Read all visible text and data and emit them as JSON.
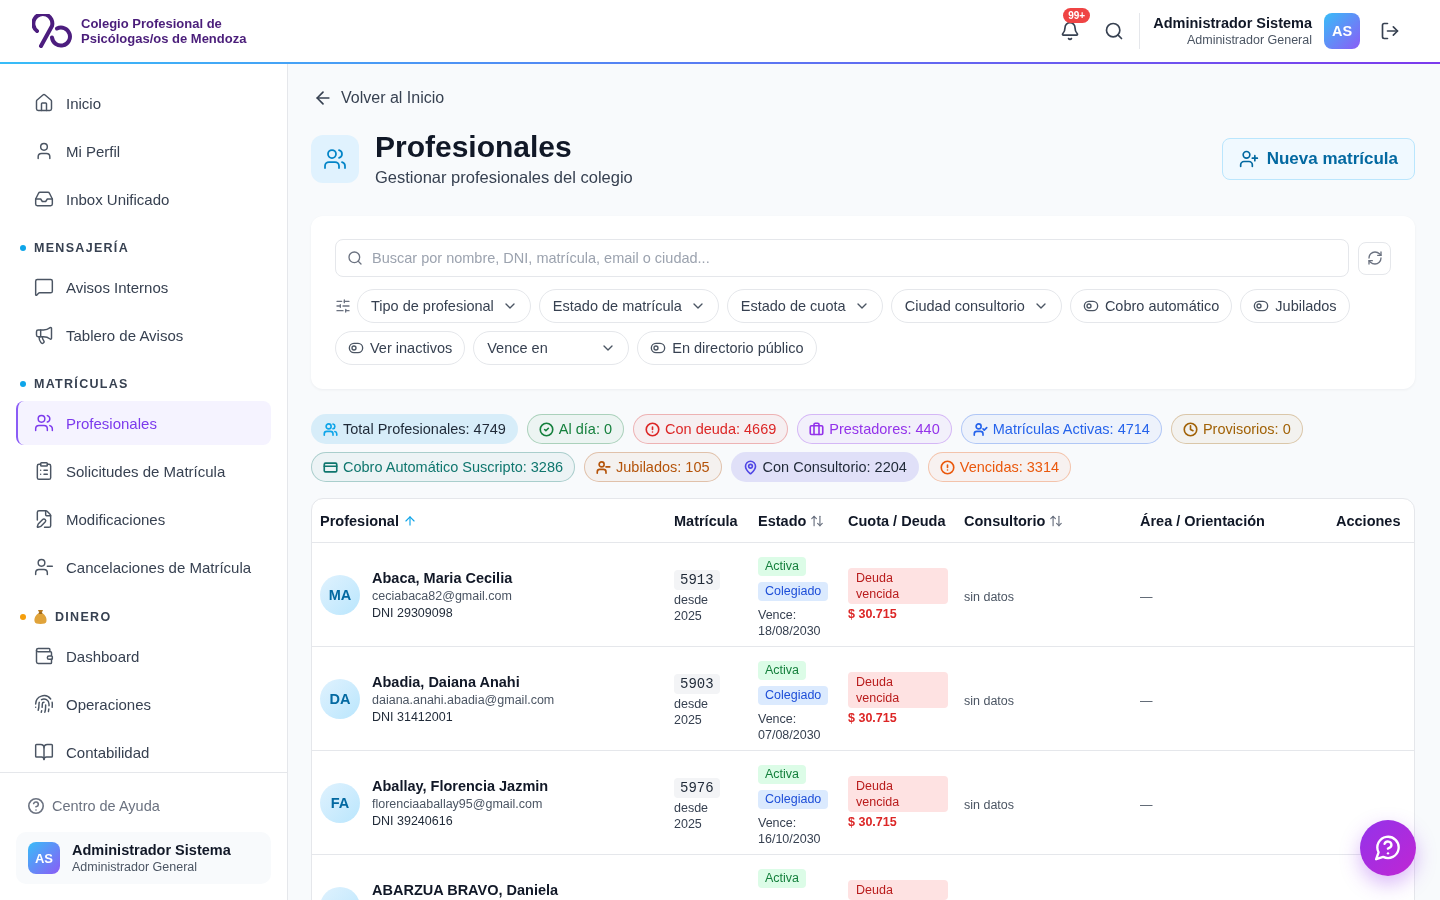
{
  "header": {
    "logo_text": "Colegio Profesional de Psicólogas/os de Mendoza",
    "notification_badge": "99+",
    "user": {
      "name": "Administrador Sistema",
      "role": "Administrador General",
      "initials": "AS"
    }
  },
  "sidebar": {
    "sections": [
      {
        "items": [
          {
            "label": "Inicio",
            "selected": false
          },
          {
            "label": "Mi Perfil",
            "selected": false
          },
          {
            "label": "Inbox Unificado",
            "selected": false
          }
        ]
      },
      {
        "title": "MENSAJERÍA",
        "color": "#0ea5e9",
        "items": [
          {
            "label": "Avisos Internos",
            "selected": false
          },
          {
            "label": "Tablero de Avisos",
            "selected": false
          }
        ]
      },
      {
        "title": "MATRÍCULAS",
        "color": "#0ea5e9",
        "items": [
          {
            "label": "Profesionales",
            "selected": true
          },
          {
            "label": "Solicitudes de Matrícula",
            "selected": false
          },
          {
            "label": "Modificaciones",
            "selected": false
          },
          {
            "label": "Cancelaciones de Matrícula",
            "selected": false
          }
        ]
      },
      {
        "title": "DINERO",
        "color": "#f59e0b",
        "items": [
          {
            "label": "Dashboard",
            "selected": false
          },
          {
            "label": "Operaciones",
            "selected": false
          },
          {
            "label": "Contabilidad",
            "selected": false
          }
        ]
      }
    ],
    "help_link": "Centro de Ayuda",
    "user": {
      "name": "Administrador Sistema",
      "role": "Administrador General",
      "initials": "AS"
    }
  },
  "page": {
    "back_link": "Volver al Inicio",
    "title": "Profesionales",
    "subtitle": "Gestionar profesionales del colegio",
    "primary_button": "Nueva matrícula"
  },
  "filters": {
    "search": {
      "placeholder": "Buscar por nombre, DNI, matrícula, email o ciudad..."
    },
    "items": [
      {
        "kind": "dropdown",
        "label": "Tipo de profesional"
      },
      {
        "kind": "dropdown",
        "label": "Estado de matrícula"
      },
      {
        "kind": "dropdown",
        "label": "Estado de cuota"
      },
      {
        "kind": "dropdown",
        "label": "Ciudad consultorio"
      },
      {
        "kind": "toggle",
        "label": "Cobro automático",
        "on": false
      },
      {
        "kind": "toggle",
        "label": "Jubilados",
        "on": false
      },
      {
        "kind": "toggle",
        "label": "Ver inactivos",
        "on": false
      },
      {
        "kind": "dropdown",
        "label": "Vence en"
      },
      {
        "kind": "toggle",
        "label": "En directorio público",
        "on": false
      }
    ]
  },
  "stats": [
    {
      "kind": "filled",
      "label": "Total Profesionales: 4749",
      "color": "#0ea5e9"
    },
    {
      "kind": "outline",
      "label": "Al día: 0",
      "color": "#15803d"
    },
    {
      "kind": "outline",
      "label": "Con deuda: 4669",
      "color": "#dc2626"
    },
    {
      "kind": "outline",
      "label": "Prestadores: 440",
      "color": "#9333ea"
    },
    {
      "kind": "outline",
      "label": "Matrículas Activas: 4714",
      "color": "#2563eb"
    },
    {
      "kind": "outline",
      "label": "Provisorios: 0",
      "color": "#a16207"
    },
    {
      "kind": "outline",
      "label": "Cobro Automático Suscripto: 3286",
      "color": "#0f766e"
    },
    {
      "kind": "outline",
      "label": "Jubilados: 105",
      "color": "#b45309"
    },
    {
      "kind": "filled",
      "label": "Con Consultorio: 2204",
      "color": "#4f46e5"
    },
    {
      "kind": "outline",
      "label": "Vencidas: 3314",
      "color": "#ea580c"
    }
  ],
  "table": {
    "columns": [
      {
        "label": "Profesional",
        "sortable": true,
        "sorted": true
      },
      {
        "label": "Matrícula",
        "sortable": false,
        "sorted": false
      },
      {
        "label": "Estado",
        "sortable": true,
        "sorted": false
      },
      {
        "label": "Cuota / Deuda",
        "sortable": false,
        "sorted": false
      },
      {
        "label": "Consultorio",
        "sortable": true,
        "sorted": false
      },
      {
        "label": "Área / Orientación",
        "sortable": false,
        "sorted": false
      },
      {
        "label": "Acciones",
        "sortable": false,
        "sorted": false
      }
    ],
    "rows": [
      {
        "initials": "MA",
        "name": "Abaca, Maria Cecilia",
        "email": "ceciabaca82@gmail.com",
        "dni": "DNI 29309098",
        "matricula": "5913",
        "since": "desde 2025",
        "status": "Activa",
        "category": "Colegiado",
        "expires": "Vence: 18/08/2030",
        "debt_label": "Deuda vencida",
        "debt_amount": "$ 30.715",
        "consultorio": "sin datos",
        "area": "—"
      },
      {
        "initials": "DA",
        "name": "Abadia, Daiana Anahi",
        "email": "daiana.anahi.abadia@gmail.com",
        "dni": "DNI 31412001",
        "matricula": "5903",
        "since": "desde 2025",
        "status": "Activa",
        "category": "Colegiado",
        "expires": "Vence: 07/08/2030",
        "debt_label": "Deuda vencida",
        "debt_amount": "$ 30.715",
        "consultorio": "sin datos",
        "area": "—"
      },
      {
        "initials": "FA",
        "name": "Aballay, Florencia Jazmin",
        "email": "florenciaaballay95@gmail.com",
        "dni": "DNI 39240616",
        "matricula": "5976",
        "since": "desde 2025",
        "status": "Activa",
        "category": "Colegiado",
        "expires": "Vence: 16/10/2030",
        "debt_label": "Deuda vencida",
        "debt_amount": "$ 30.715",
        "consultorio": "sin datos",
        "area": "—"
      },
      {
        "name": "ABARZUA BRAVO, Daniela",
        "status": "Activa",
        "debt_label": "Deuda"
      }
    ]
  }
}
